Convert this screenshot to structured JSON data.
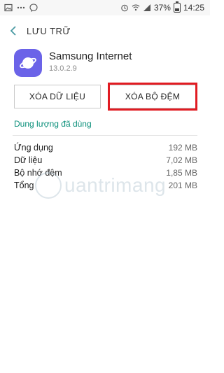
{
  "status_bar": {
    "battery": "37%",
    "time": "14:25",
    "icons": [
      "image-icon",
      "dots-icon",
      "messenger-icon",
      "alarm-icon",
      "wifi-icon",
      "signal-icon",
      "battery-icon"
    ]
  },
  "header": {
    "title": "LƯU TRỮ"
  },
  "app": {
    "name": "Samsung Internet",
    "version": "13.0.2.9"
  },
  "buttons": {
    "clear_data": "XÓA DỮ LIỆU",
    "clear_cache": "XÓA BỘ ĐỆM"
  },
  "section": {
    "title": "Dung lượng đã dùng"
  },
  "usage": [
    {
      "label": "Ứng dụng",
      "value": "192 MB"
    },
    {
      "label": "Dữ liệu",
      "value": "7,02 MB"
    },
    {
      "label": "Bộ nhớ đệm",
      "value": "1,85 MB"
    },
    {
      "label": "Tổng",
      "value": "201 MB"
    }
  ],
  "colors": {
    "accent": "#0a8f7a",
    "highlight": "#e11b22",
    "app_icon": "#6b63e8"
  },
  "watermark": {
    "text": "uantrimang"
  }
}
